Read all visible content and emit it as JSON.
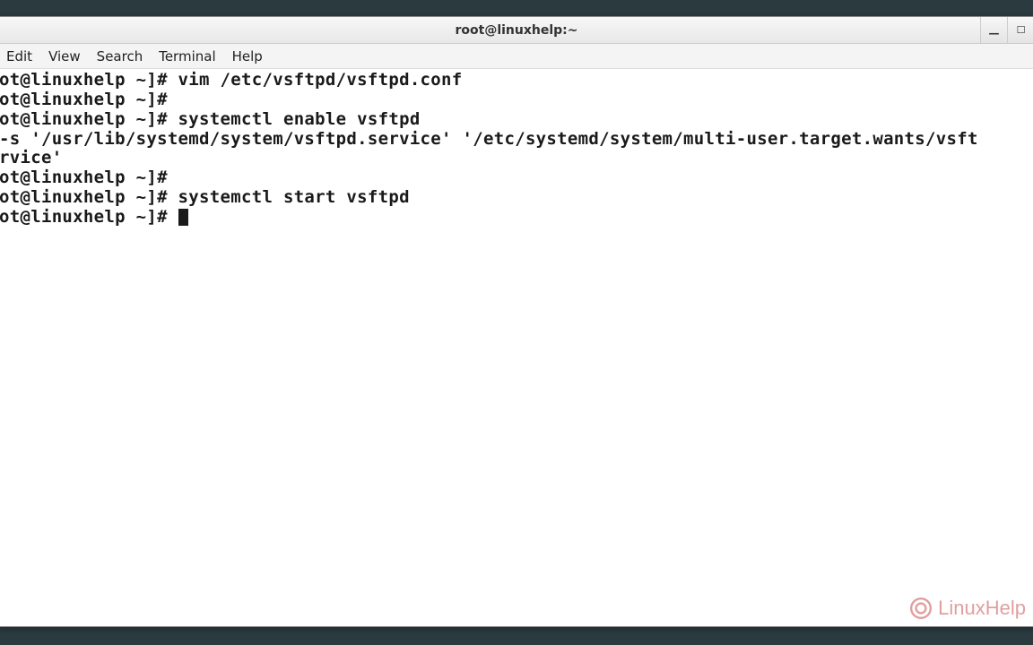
{
  "titlebar": {
    "title": "root@linuxhelp:~"
  },
  "menubar": {
    "edit": "Edit",
    "view": "View",
    "search": "Search",
    "terminal": "Terminal",
    "help": "Help"
  },
  "terminal": {
    "line1": "ot@linuxhelp ~]# vim /etc/vsftpd/vsftpd.conf",
    "line2": "ot@linuxhelp ~]#",
    "line3": "ot@linuxhelp ~]# systemctl enable vsftpd",
    "line4": "-s '/usr/lib/systemd/system/vsftpd.service' '/etc/systemd/system/multi-user.target.wants/vsft",
    "line5": "rvice'",
    "line6": "ot@linuxhelp ~]#",
    "line7": "ot@linuxhelp ~]# systemctl start vsftpd",
    "line8": "ot@linuxhelp ~]# "
  },
  "watermark": {
    "text": "LinuxHelp"
  }
}
